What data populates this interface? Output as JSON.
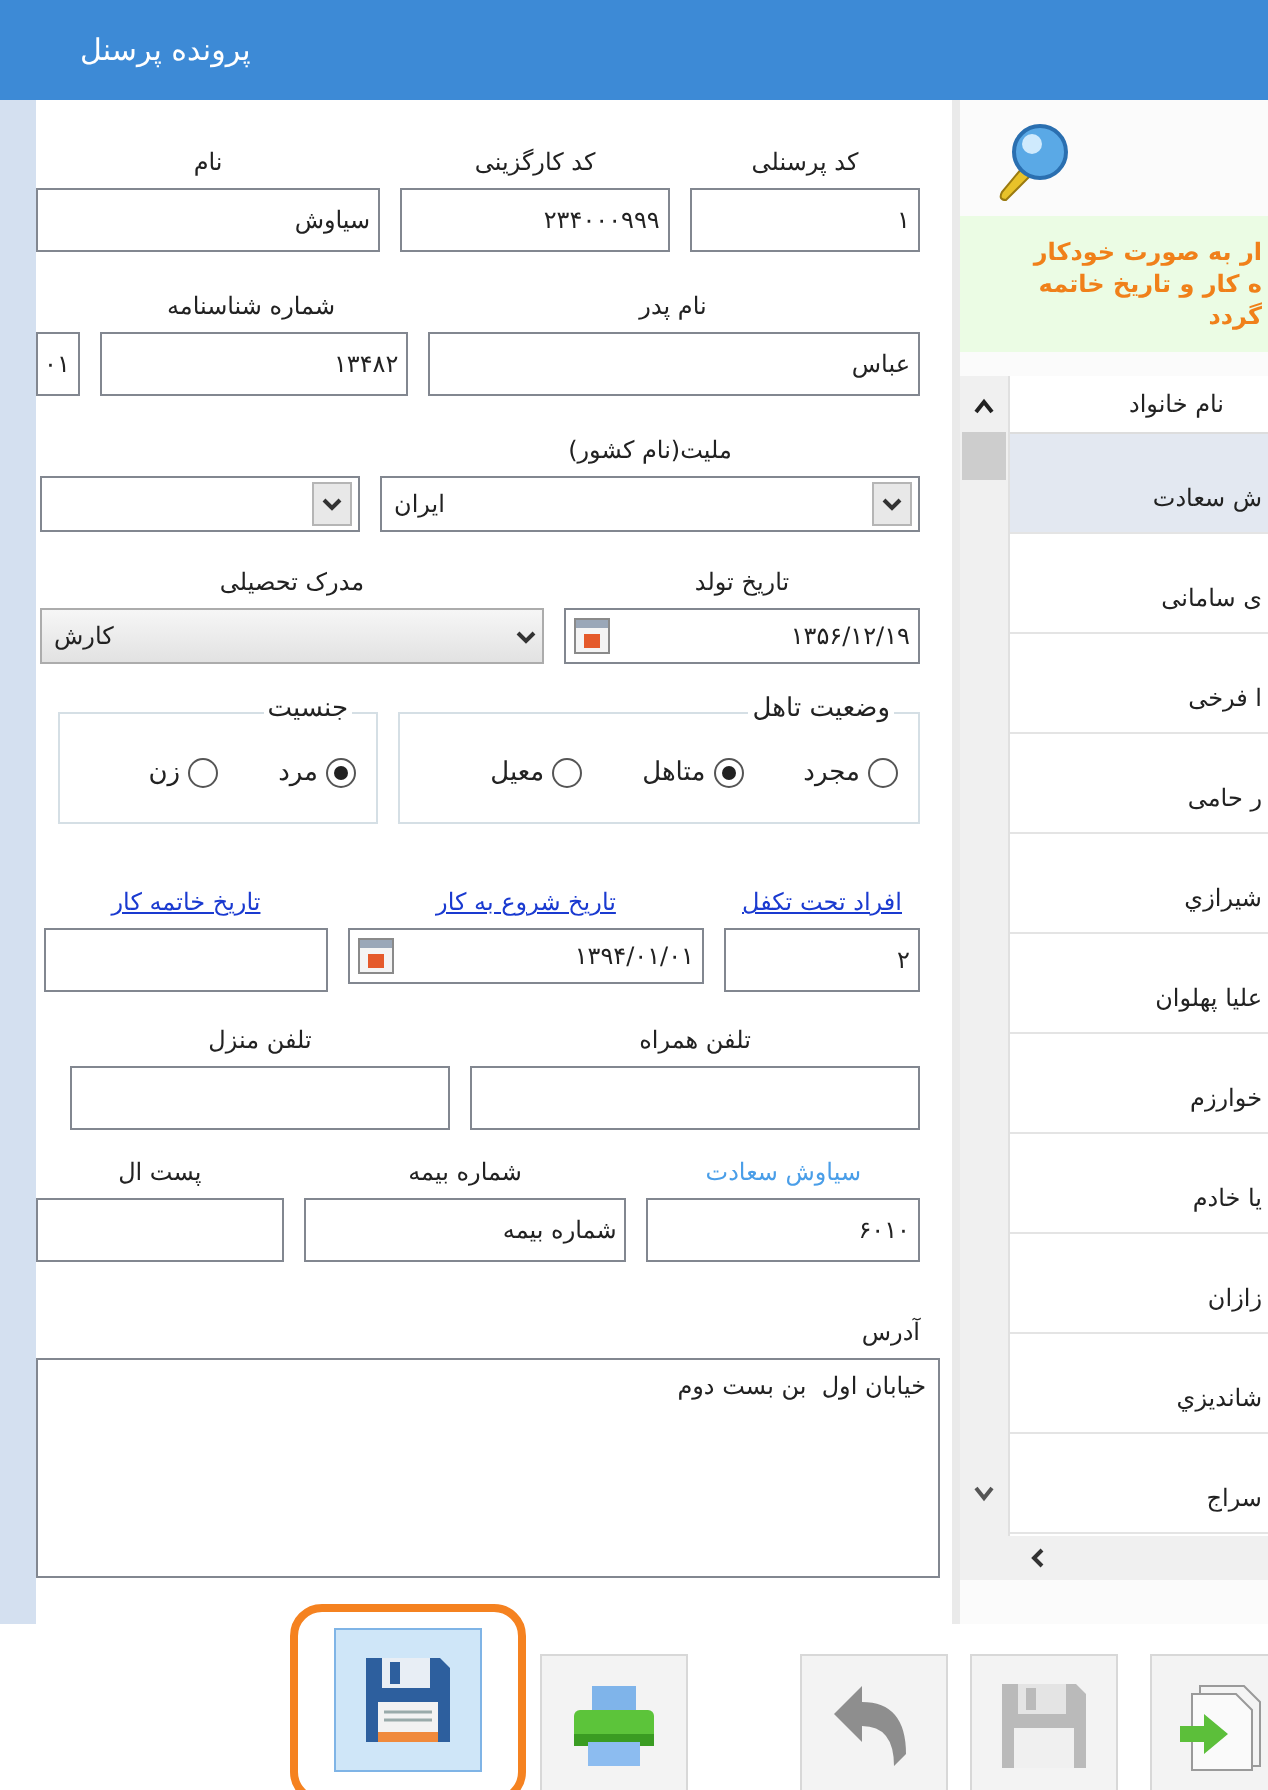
{
  "window": {
    "title": "پرونده پرسنل"
  },
  "form": {
    "rows": [
      {
        "labels": [
          {
            "kind": "label",
            "text": "کد پرسنلی"
          },
          {
            "kind": "label",
            "text": "کد کارگزینی"
          },
          {
            "kind": "label",
            "text": "نام"
          }
        ],
        "fields": [
          {
            "kind": "text",
            "value": "۱"
          },
          {
            "kind": "text",
            "value": "۲۳۴۰۰۰۹۹۹"
          },
          {
            "kind": "text",
            "value": "سیاوش"
          }
        ]
      },
      {
        "labels": [
          {
            "kind": "label",
            "text": "نام پدر"
          },
          {
            "kind": "label",
            "text": "شماره شناسنامه"
          }
        ],
        "fields": [
          {
            "kind": "text",
            "value": "عباس"
          },
          {
            "kind": "text",
            "value": "۱۳۴۸۲"
          },
          {
            "kind": "text",
            "value": "۰۱"
          }
        ]
      },
      {
        "labels": [
          {
            "kind": "label",
            "text": "ملیت(نام کشور)"
          }
        ],
        "fields": [
          {
            "kind": "select",
            "value": "ایران",
            "disabled": false
          },
          {
            "kind": "select",
            "disabled": false
          }
        ]
      },
      {
        "labels": [
          {
            "kind": "label",
            "text": "تاریخ تولد"
          },
          {
            "kind": "label",
            "text": "مدرک تحصیلی"
          }
        ],
        "fields": [
          {
            "kind": "date",
            "value": "۱۳۵۶/۱۲/۱۹"
          },
          {
            "kind": "select",
            "value": "کارش",
            "disabled": true
          }
        ]
      },
      {
        "labels": [],
        "fields": [
          {
            "kind": "radio-group",
            "legend": "وضعیت تاهل",
            "options": [
              {
                "label": "مجرد",
                "selected": false
              },
              {
                "label": "متاهل",
                "selected": true
              },
              {
                "label": "معیل",
                "selected": false
              }
            ]
          },
          {
            "kind": "radio-group",
            "legend": "جنسیت",
            "options": [
              {
                "label": "مرد",
                "selected": true
              },
              {
                "label": "زن",
                "selected": false
              }
            ]
          }
        ]
      },
      {
        "labels": [
          {
            "kind": "link",
            "text": "افراد تحت تکفل"
          },
          {
            "kind": "link",
            "text": "تاریخ شروع به کار"
          },
          {
            "kind": "link",
            "text": "تاریخ خاتمه کار"
          }
        ],
        "fields": [
          {
            "kind": "text",
            "value": "۲"
          },
          {
            "kind": "date",
            "value": "۱۳۹۴/۰۱/۰۱"
          },
          {
            "kind": "text"
          }
        ]
      },
      {
        "labels": [
          {
            "kind": "label",
            "text": "تلفن همراه"
          },
          {
            "kind": "label",
            "text": "تلفن منزل"
          }
        ],
        "fields": [
          {
            "kind": "text"
          },
          {
            "kind": "text"
          }
        ]
      },
      {
        "labels": [
          {
            "kind": "name",
            "text": "سیاوش سعادت"
          },
          {
            "kind": "label",
            "text": "شماره بیمه"
          },
          {
            "kind": "label",
            "text": "پست ال"
          }
        ],
        "fields": [
          {
            "kind": "text",
            "value": "۶۰۱۰"
          },
          {
            "kind": "text",
            "value": "شماره بیمه"
          },
          {
            "kind": "text"
          }
        ]
      },
      {
        "labels": [
          {
            "kind": "label",
            "text": "آدرس"
          }
        ],
        "fields": [
          {
            "kind": "textarea",
            "value": "خیابان اول  بن بست دوم"
          }
        ]
      }
    ]
  },
  "sidebar": {
    "note_lines": [
      "ار به صورت خودکار",
      "ه کار و تاریخ خاتمه",
      "گردد"
    ],
    "list": {
      "header": "نام خانواد",
      "rows": [
        {
          "name": "ش سعادت",
          "selected": true
        },
        {
          "name": "ی سامانی",
          "selected": false
        },
        {
          "name": "ا فرخی",
          "selected": false
        },
        {
          "name": "ر حامی",
          "selected": false
        },
        {
          "name": "شیرازي",
          "selected": false
        },
        {
          "name": "علیا پهلوان",
          "selected": false
        },
        {
          "name": "خوارزم",
          "selected": false
        },
        {
          "name": "یا خادم",
          "selected": false
        },
        {
          "name": "زازان",
          "selected": false
        },
        {
          "name": "شاندیزي",
          "selected": false
        },
        {
          "name": "سراج",
          "selected": false
        }
      ]
    }
  },
  "toolbar": {
    "buttons": [
      {
        "kind": "save",
        "disabled": false,
        "highlighted": true
      },
      {
        "kind": "print",
        "disabled": false,
        "highlighted": false
      },
      {
        "kind": "undo",
        "disabled": false,
        "highlighted": false
      },
      {
        "kind": "save",
        "disabled": true,
        "highlighted": false
      },
      {
        "kind": "export",
        "disabled": false,
        "highlighted": false
      }
    ]
  }
}
